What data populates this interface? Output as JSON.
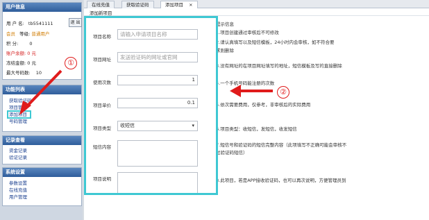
{
  "user_panel": {
    "title": "用户信息",
    "user_label": "用 户 名:",
    "user_value": "tb5541111",
    "logout_label": "退 出",
    "member_label": "会员",
    "level_label": "等级:",
    "level_value": "普通用户",
    "points_label": "积 分:",
    "points_value": "0",
    "balance_label": "账户余额:",
    "balance_value": "0 元",
    "frozen_label": "冻结金额:",
    "frozen_value": "0 元",
    "max_label": "最大号码数:",
    "max_value": "10"
  },
  "func_panel": {
    "title": "功能列表",
    "items": [
      "获取验证码",
      "项目管理",
      "添加项目",
      "号码管理"
    ]
  },
  "record_panel": {
    "title": "记录查看",
    "items": [
      "资金记录",
      "验证记录"
    ]
  },
  "sys_panel": {
    "title": "系统设置",
    "items": [
      "参数设置",
      "在线充值",
      "用户管理"
    ]
  },
  "tabs": [
    {
      "label": "在线充值"
    },
    {
      "label": "获取验证码"
    },
    {
      "label": "添加项目",
      "close": "×"
    }
  ],
  "form": {
    "section_title": "添加新项目",
    "name_label": "项目名称",
    "name_placeholder": "请输入申请项目名称",
    "url_label": "项目网址",
    "url_placeholder": "发送验证码的网址或官网",
    "count_label": "使用次数",
    "count_value": "1",
    "price_label": "项目单价",
    "price_value": "0.1",
    "type_label": "项目类型",
    "type_value": "收短信",
    "content_label": "短信内容",
    "desc_label": "项目说明"
  },
  "help": {
    "title": "提示信息",
    "lines": [
      "1.项目创建通过审核后不可修改",
      "2.请认真填写以及短信模板，24小时内会审核，如不符合要",
      "求则删除",
      "3.没有网址的在项目网址填写的地址，短信模板及写的直接删除",
      "4.一个手机号码能注册的次数",
      "5.依次需要费用，仅参考，非审核后的实际费用",
      "6.项目类型：收短信，发短信，收发短信",
      "7.短信号和验证码的短信完整内容（此项填写不正确可能会审核不",
      "过验证码短信）",
      "8.此项目，若是APP接收验证码，也可以再次说明，方便管理员到"
    ]
  },
  "annotations": {
    "one": "①",
    "two": "②"
  },
  "colors": {
    "highlight": "#3ec8d3",
    "arrow": "#e01b1b",
    "panel_header": "#2f5d9b"
  }
}
